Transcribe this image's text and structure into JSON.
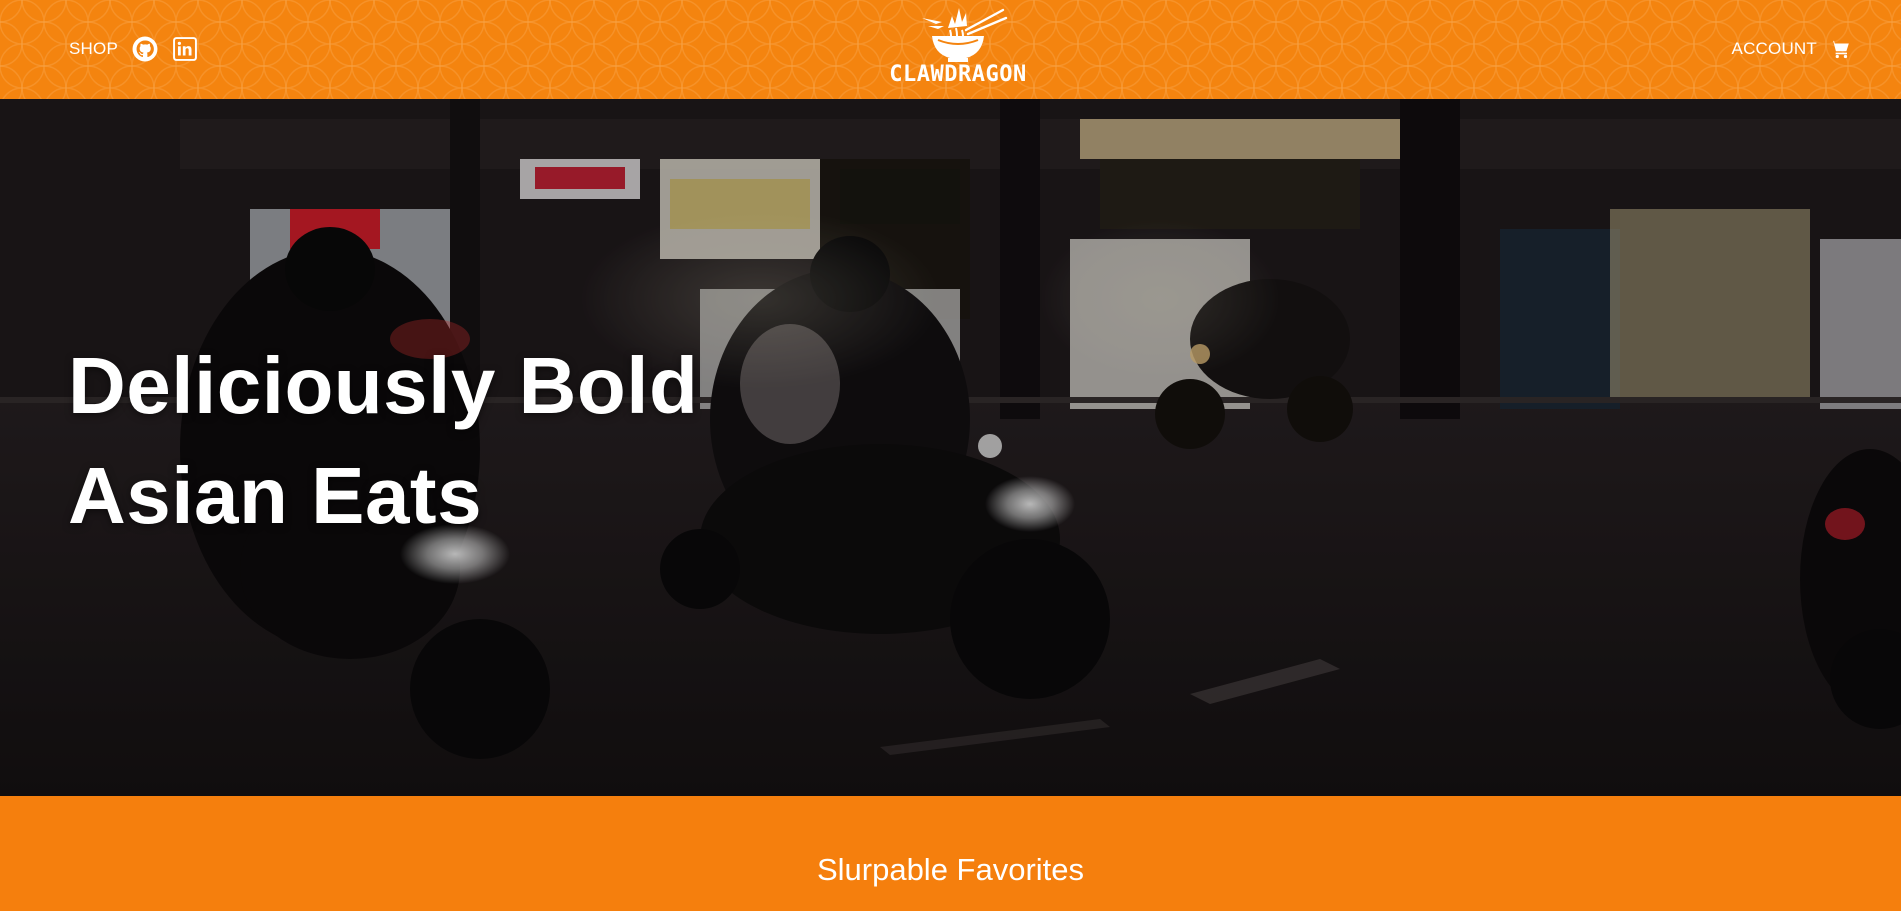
{
  "header": {
    "shop_label": "SHOP",
    "account_label": "ACCOUNT",
    "logo_text": "CLAWDRAGON",
    "social_icons": [
      "github-icon",
      "linkedin-icon"
    ],
    "cart_icon": "shopping-cart-icon",
    "background_color": "#f4840f"
  },
  "hero": {
    "title_line1": "Deliciously Bold",
    "title_line2": "Asian Eats",
    "background": "night street scene with motorbikes and storefronts"
  },
  "favorites": {
    "title": "Slurpable Favorites",
    "background_color": "#f57f0d"
  }
}
